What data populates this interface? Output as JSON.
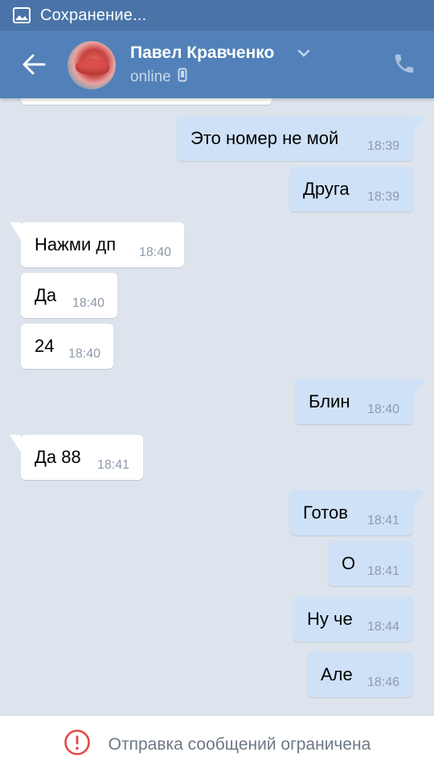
{
  "status_bar": {
    "text": "Сохранение...",
    "icon": "image-icon"
  },
  "header": {
    "name": "Павел Кравченко",
    "status": "online",
    "icons": [
      "back-arrow-icon",
      "chevron-down-icon",
      "mobile-icon",
      "phone-icon"
    ],
    "accent_color": "#5181b8"
  },
  "messages": [
    {
      "dir": "out",
      "text": "Это номер не мой",
      "time": "18:39",
      "tail": true
    },
    {
      "dir": "out",
      "text": "Друга",
      "time": "18:39",
      "tail": false
    },
    {
      "dir": "in",
      "text": "Нажми дп",
      "time": "18:40",
      "tail": true
    },
    {
      "dir": "in",
      "text": "Да",
      "time": "18:40",
      "tail": false
    },
    {
      "dir": "in",
      "text": "24",
      "time": "18:40",
      "tail": false
    },
    {
      "dir": "out",
      "text": "Блин",
      "time": "18:40",
      "tail": true
    },
    {
      "dir": "in",
      "text": "Да 88",
      "time": "18:41",
      "tail": true
    },
    {
      "dir": "out",
      "text": "Готов",
      "time": "18:41",
      "tail": true
    },
    {
      "dir": "out",
      "text": "О",
      "time": "18:41",
      "tail": false
    },
    {
      "dir": "out",
      "text": "Ну че",
      "time": "18:44",
      "tail": false
    },
    {
      "dir": "out",
      "text": "Але",
      "time": "18:46",
      "tail": false
    }
  ],
  "footer": {
    "text": "Отправка сообщений ограничена",
    "icon": "warning-icon",
    "icon_color": "#e64646"
  },
  "colors": {
    "incoming_bubble": "#ffffff",
    "outgoing_bubble": "#cfe1f7",
    "background": "#dde4ed"
  }
}
